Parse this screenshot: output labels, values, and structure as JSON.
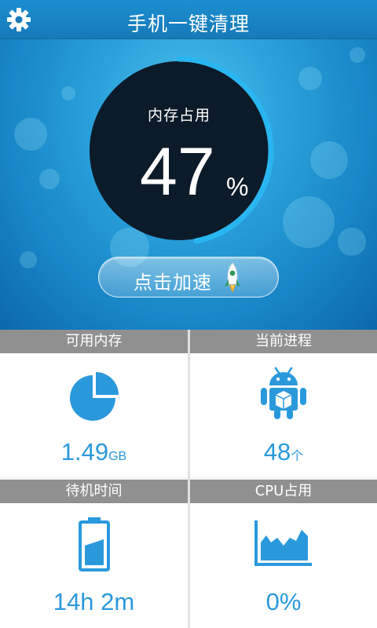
{
  "header": {
    "title": "手机一键清理",
    "settings_icon": "gear-icon"
  },
  "memory_gauge": {
    "label": "内存占用",
    "value": "47",
    "unit": "%",
    "progress_percent": 47
  },
  "boost": {
    "label": "点击加速",
    "icon": "rocket-icon"
  },
  "stats": [
    {
      "title": "可用内存",
      "value": "1.49",
      "unit": "GB",
      "icon": "pie-chart-icon"
    },
    {
      "title": "当前进程",
      "value": "48",
      "unit": "个",
      "icon": "android-box-icon"
    },
    {
      "title": "待机时间",
      "value": "14h 2m",
      "unit": "",
      "icon": "battery-icon"
    },
    {
      "title": "CPU占用",
      "value": "0%",
      "unit": "",
      "icon": "area-chart-icon"
    }
  ],
  "colors": {
    "accent": "#2a99dc",
    "header": "#1779b9",
    "gauge_dark": "#0c1b29",
    "gauge_arc": "#29b6f0",
    "card_header": "#909090"
  }
}
